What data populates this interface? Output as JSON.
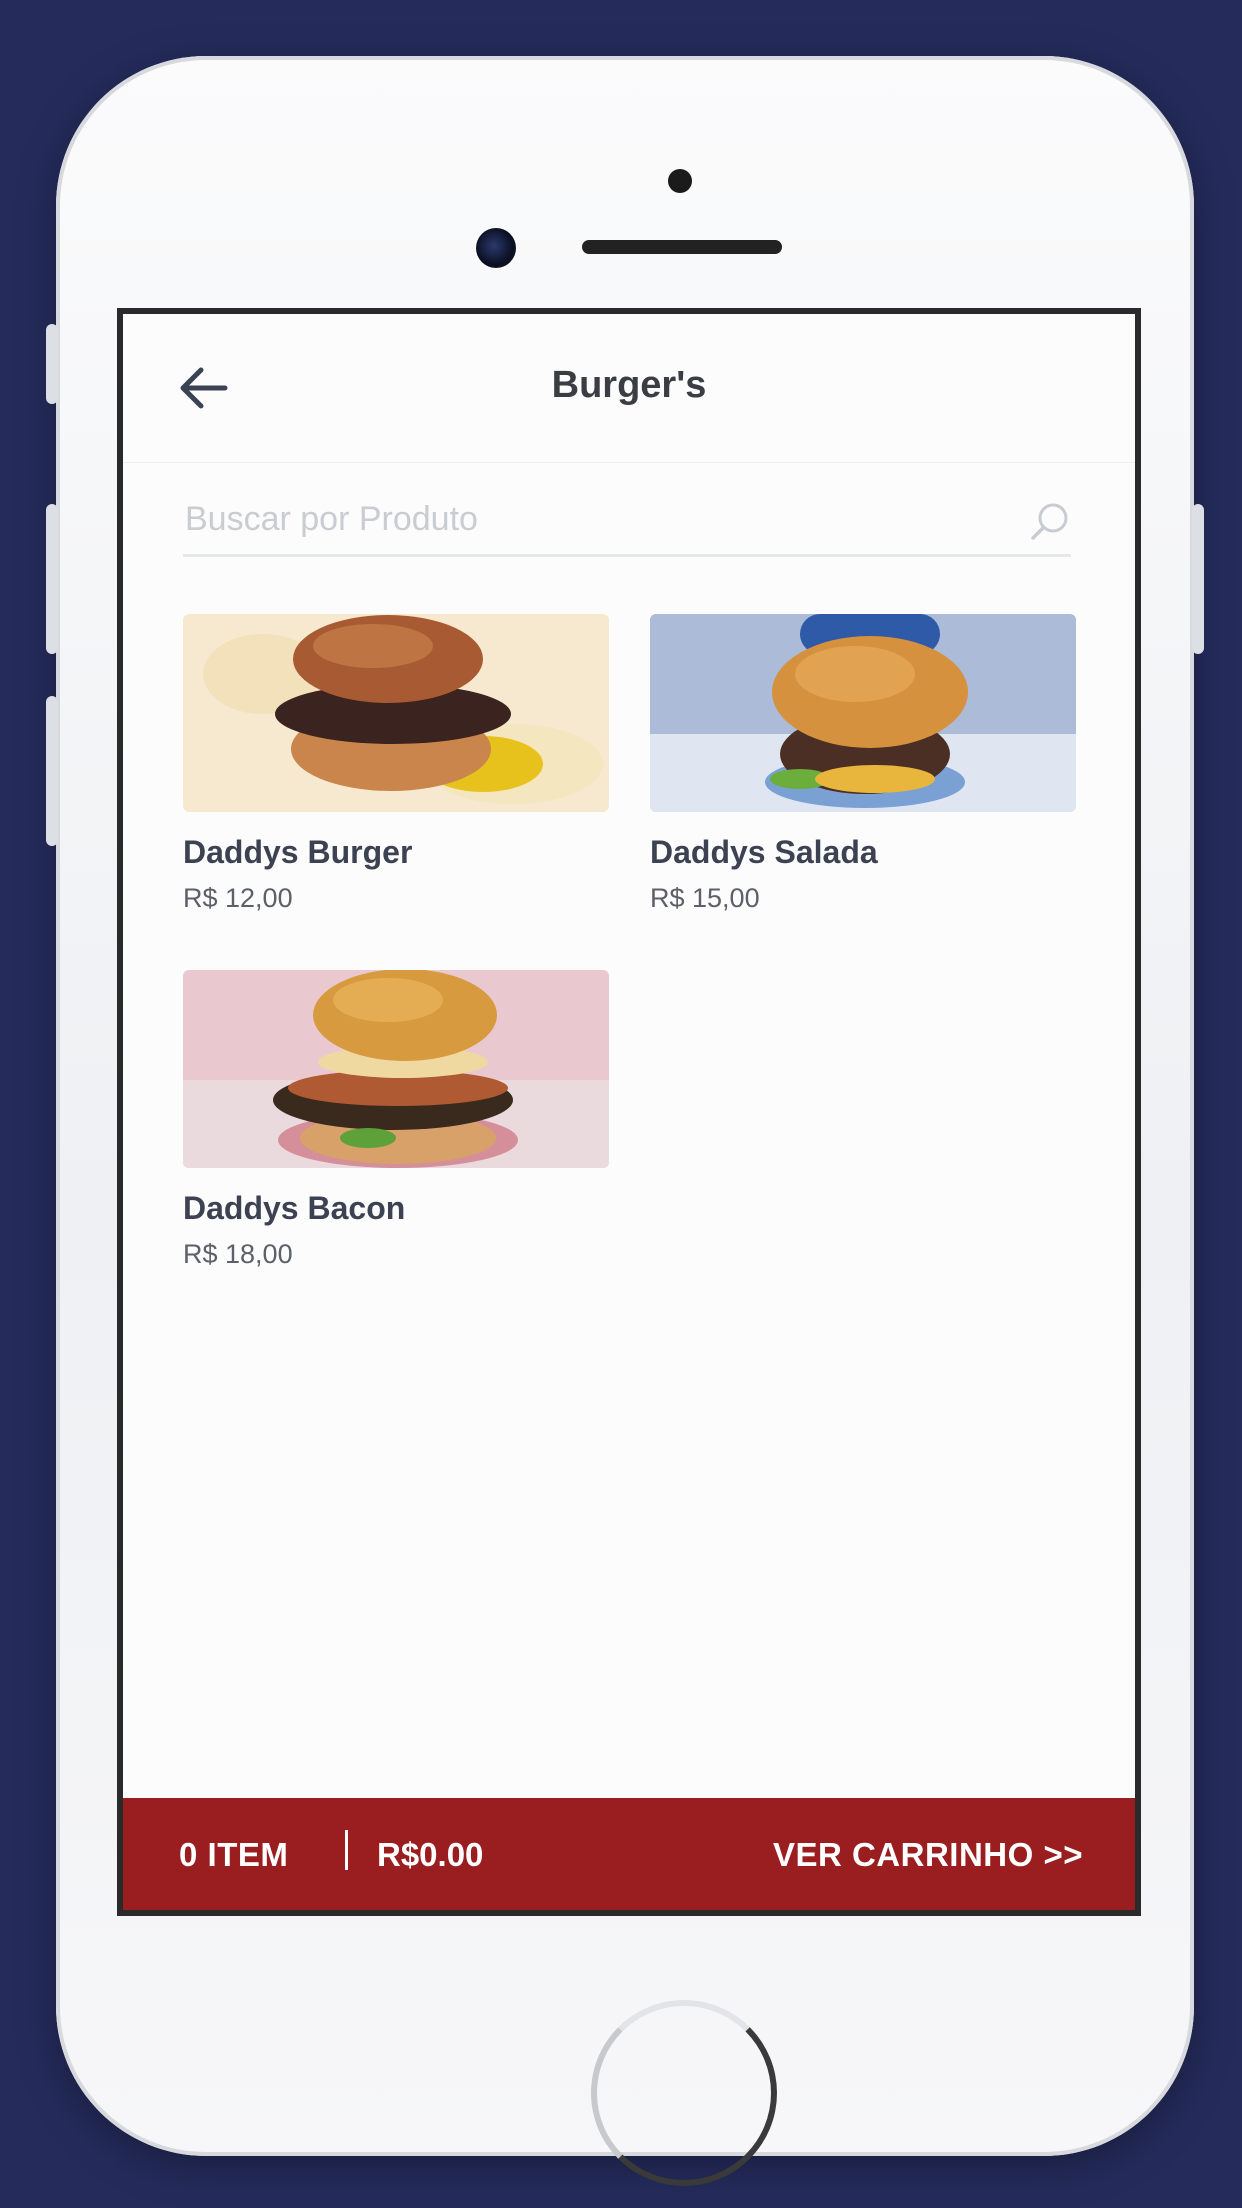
{
  "colors": {
    "background": "#252c5c",
    "accent": "#9a1d20"
  },
  "header": {
    "title": "Burger's",
    "back_icon": "arrow-left-icon"
  },
  "search": {
    "placeholder": "Buscar por Produto",
    "icon": "search-icon"
  },
  "products": [
    {
      "name": "Daddys Burger",
      "price": "R$ 12,00"
    },
    {
      "name": "Daddys Salada",
      "price": "R$ 15,00"
    },
    {
      "name": "Daddys Bacon",
      "price": "R$ 18,00"
    }
  ],
  "cart_bar": {
    "items": "0 ITEM",
    "total": "R$0.00",
    "cta": "VER CARRINHO >>"
  }
}
